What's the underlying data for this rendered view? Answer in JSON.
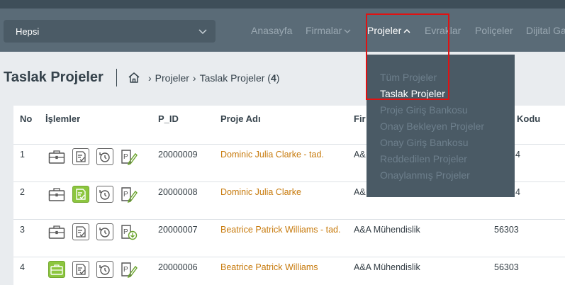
{
  "filter": {
    "value": "Hepsi"
  },
  "nav": {
    "items": [
      {
        "label": "Anasayfa",
        "has_chevron": false
      },
      {
        "label": "Firmalar",
        "has_chevron": true
      },
      {
        "label": "Projeler",
        "has_chevron": true,
        "active": true
      },
      {
        "label": "Evraklar",
        "has_chevron": false
      },
      {
        "label": "Poliçeler",
        "has_chevron": false
      },
      {
        "label": "Dijital Ga",
        "has_chevron": false
      }
    ]
  },
  "page": {
    "title": "Taslak Projeler",
    "breadcrumb": {
      "item1": "Projeler",
      "item2": "Taslak Projeler (",
      "count": "4",
      "close": ")"
    }
  },
  "table": {
    "headers": {
      "no": "No",
      "actions": "İşlemler",
      "pid": "P_ID",
      "name": "Proje Adı",
      "firm": "Fir",
      "code": "Kodu"
    },
    "rows": [
      {
        "no": "1",
        "pid": "20000009",
        "name": "Dominic Julia Clarke - tad.",
        "firm": "A&",
        "code": "4"
      },
      {
        "no": "2",
        "pid": "20000008",
        "name": "Dominic Julia Clarke",
        "firm": "A&",
        "code": "4"
      },
      {
        "no": "3",
        "pid": "20000007",
        "name": "Beatrice Patrick Williams - tad.",
        "firm": "A&A Mühendislik",
        "code": "56303"
      },
      {
        "no": "4",
        "pid": "20000006",
        "name": "Beatrice Patrick Williams",
        "firm": "A&A Mühendislik",
        "code": "56303"
      }
    ]
  },
  "dropdown": {
    "items": [
      {
        "label": "Tüm Projeler"
      },
      {
        "label": "Taslak Projeler",
        "active": true
      },
      {
        "label": "Proje Giriş Bankosu"
      },
      {
        "label": "Onay Bekleyen Projeler"
      },
      {
        "label": "Onay Giriş Bankosu"
      },
      {
        "label": "Reddedilen Projeler"
      },
      {
        "label": "Onaylanmış Projeler"
      }
    ]
  },
  "colors": {
    "navbar": "#5a6b77",
    "link": "#c77a0c",
    "green": "#8cc63f",
    "highlight": "#e01212"
  }
}
